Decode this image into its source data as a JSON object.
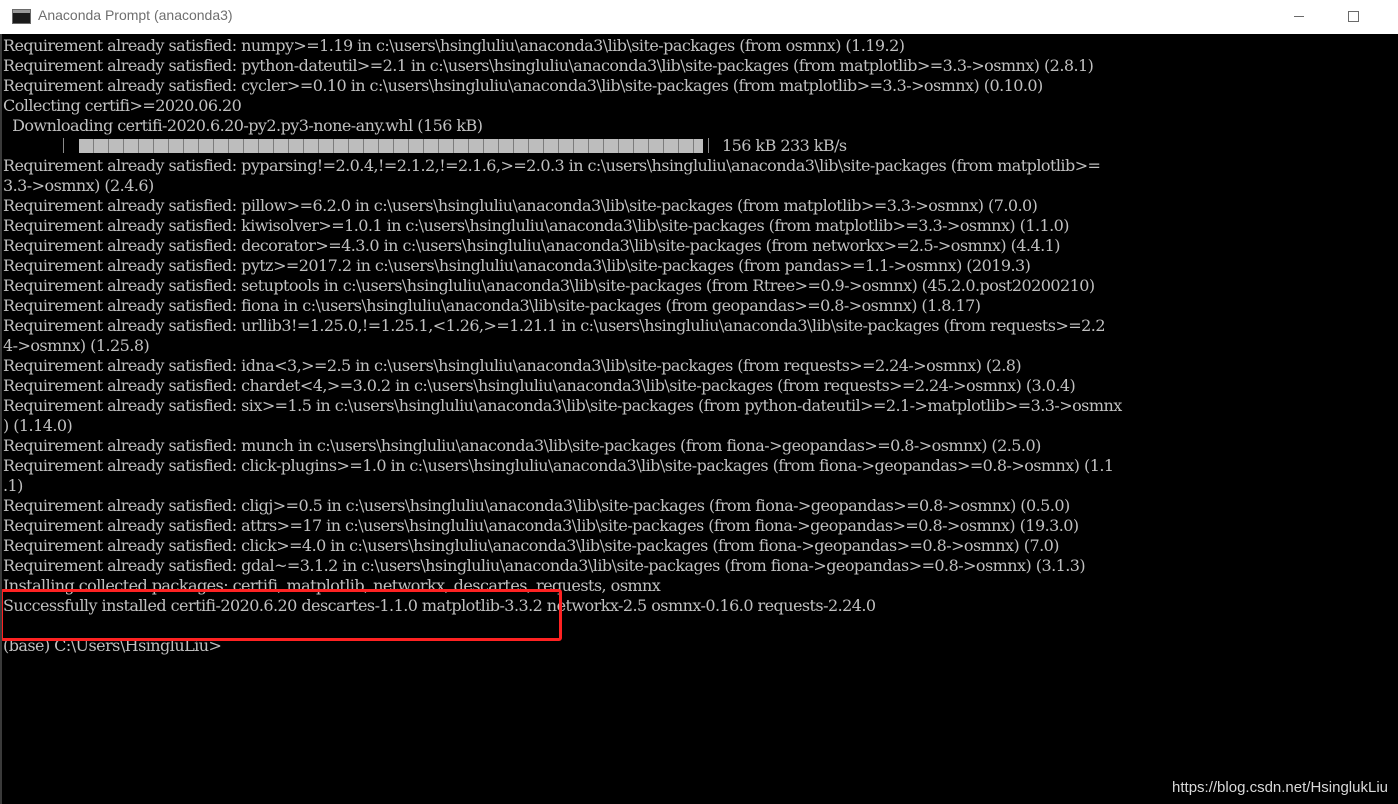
{
  "window": {
    "title": "Anaconda Prompt (anaconda3)",
    "icon": "console-icon",
    "controls": [
      "minimize-icon",
      "maximize-icon"
    ]
  },
  "console": {
    "background": "#000000",
    "text_color": "#c0c0c0",
    "highlight_color": "#ff2222",
    "lines_before_progress": [
      "Requirement already satisfied: numpy>=1.19 in c:\\users\\hsingluliu\\anaconda3\\lib\\site-packages (from osmnx) (1.19.2)",
      "Requirement already satisfied: python-dateutil>=2.1 in c:\\users\\hsingluliu\\anaconda3\\lib\\site-packages (from matplotlib>=3.3->osmnx) (2.8.1)",
      "Requirement already satisfied: cycler>=0.10 in c:\\users\\hsingluliu\\anaconda3\\lib\\site-packages (from matplotlib>=3.3->osmnx) (0.10.0)",
      "Collecting certifi>=2020.06.20",
      "  Downloading certifi-2020.6.20-py2.py3-none-any.whl (156 kB)"
    ],
    "progress": {
      "fraction": 1.0,
      "text": "156 kB 233 kB/s"
    },
    "lines_after_progress": [
      "Requirement already satisfied: pyparsing!=2.0.4,!=2.1.2,!=2.1.6,>=2.0.3 in c:\\users\\hsingluliu\\anaconda3\\lib\\site-packages (from matplotlib>=",
      "3.3->osmnx) (2.4.6)",
      "Requirement already satisfied: pillow>=6.2.0 in c:\\users\\hsingluliu\\anaconda3\\lib\\site-packages (from matplotlib>=3.3->osmnx) (7.0.0)",
      "Requirement already satisfied: kiwisolver>=1.0.1 in c:\\users\\hsingluliu\\anaconda3\\lib\\site-packages (from matplotlib>=3.3->osmnx) (1.1.0)",
      "Requirement already satisfied: decorator>=4.3.0 in c:\\users\\hsingluliu\\anaconda3\\lib\\site-packages (from networkx>=2.5->osmnx) (4.4.1)",
      "Requirement already satisfied: pytz>=2017.2 in c:\\users\\hsingluliu\\anaconda3\\lib\\site-packages (from pandas>=1.1->osmnx) (2019.3)",
      "Requirement already satisfied: setuptools in c:\\users\\hsingluliu\\anaconda3\\lib\\site-packages (from Rtree>=0.9->osmnx) (45.2.0.post20200210)",
      "Requirement already satisfied: fiona in c:\\users\\hsingluliu\\anaconda3\\lib\\site-packages (from geopandas>=0.8->osmnx) (1.8.17)",
      "Requirement already satisfied: urllib3!=1.25.0,!=1.25.1,<1.26,>=1.21.1 in c:\\users\\hsingluliu\\anaconda3\\lib\\site-packages (from requests>=2.2",
      "4->osmnx) (1.25.8)",
      "Requirement already satisfied: idna<3,>=2.5 in c:\\users\\hsingluliu\\anaconda3\\lib\\site-packages (from requests>=2.24->osmnx) (2.8)",
      "Requirement already satisfied: chardet<4,>=3.0.2 in c:\\users\\hsingluliu\\anaconda3\\lib\\site-packages (from requests>=2.24->osmnx) (3.0.4)",
      "Requirement already satisfied: six>=1.5 in c:\\users\\hsingluliu\\anaconda3\\lib\\site-packages (from python-dateutil>=2.1->matplotlib>=3.3->osmnx",
      ") (1.14.0)",
      "Requirement already satisfied: munch in c:\\users\\hsingluliu\\anaconda3\\lib\\site-packages (from fiona->geopandas>=0.8->osmnx) (2.5.0)",
      "Requirement already satisfied: click-plugins>=1.0 in c:\\users\\hsingluliu\\anaconda3\\lib\\site-packages (from fiona->geopandas>=0.8->osmnx) (1.1",
      ".1)",
      "Requirement already satisfied: cligj>=0.5 in c:\\users\\hsingluliu\\anaconda3\\lib\\site-packages (from fiona->geopandas>=0.8->osmnx) (0.5.0)",
      "Requirement already satisfied: attrs>=17 in c:\\users\\hsingluliu\\anaconda3\\lib\\site-packages (from fiona->geopandas>=0.8->osmnx) (19.3.0)",
      "Requirement already satisfied: click>=4.0 in c:\\users\\hsingluliu\\anaconda3\\lib\\site-packages (from fiona->geopandas>=0.8->osmnx) (7.0)",
      "Requirement already satisfied: gdal~=3.1.2 in c:\\users\\hsingluliu\\anaconda3\\lib\\site-packages (from fiona->geopandas>=0.8->osmnx) (3.1.3)",
      "Installing collected packages: certifi, matplotlib, networkx, descartes, requests, osmnx",
      "Successfully installed certifi-2020.6.20 descartes-1.1.0 matplotlib-3.3.2 networkx-2.5 osmnx-0.16.0 requests-2.24.0",
      "",
      "(base) C:\\Users\\HsingluLiu>"
    ]
  },
  "watermark": "https://blog.csdn.net/HsinglukLiu"
}
